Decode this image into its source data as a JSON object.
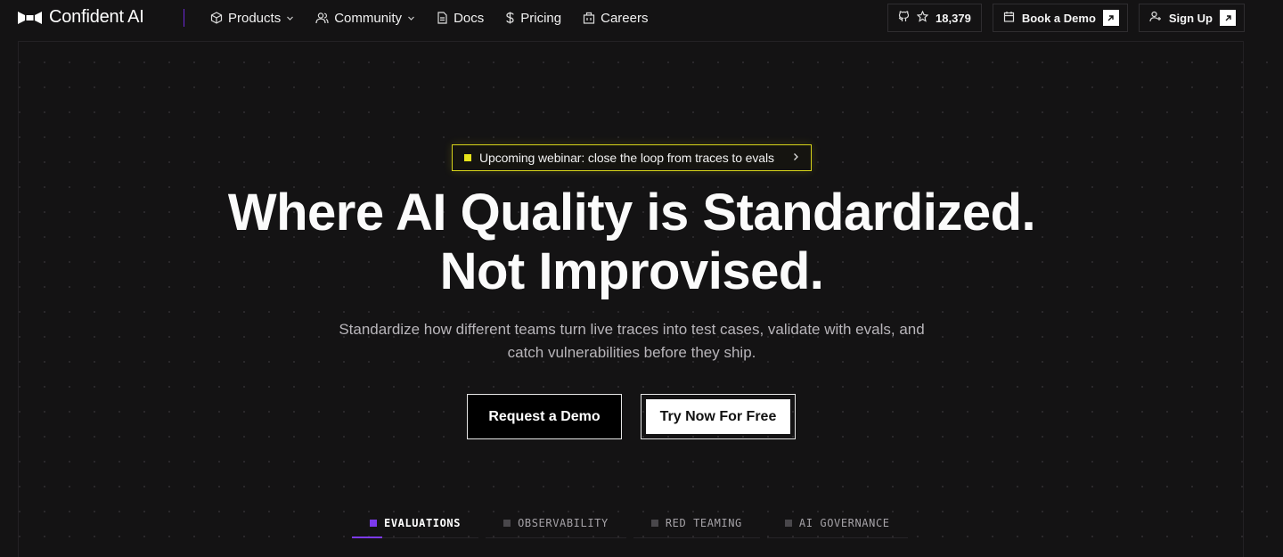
{
  "brand": {
    "name": "Confident AI"
  },
  "nav": {
    "items": [
      {
        "label": "Products",
        "icon": "cube-icon",
        "has_dropdown": true
      },
      {
        "label": "Community",
        "icon": "users-icon",
        "has_dropdown": true
      },
      {
        "label": "Docs",
        "icon": "document-icon",
        "has_dropdown": false
      },
      {
        "label": "Pricing",
        "icon": "dollar-icon",
        "has_dropdown": false
      },
      {
        "label": "Careers",
        "icon": "building-icon",
        "has_dropdown": false
      }
    ],
    "github_stars": "18,379",
    "book_demo": "Book a Demo",
    "sign_up": "Sign Up"
  },
  "banner": {
    "text": "Upcoming webinar: close the loop from traces to evals"
  },
  "hero": {
    "headline_line1": "Where AI Quality is Standardized.",
    "headline_line2": "Not Improvised.",
    "sub_line1": "Standardize how different teams turn live traces into test cases, validate with evals, and",
    "sub_line2": "catch vulnerabilities before they ship.",
    "cta_primary": "Request a Demo",
    "cta_secondary": "Try Now For Free"
  },
  "tabs": [
    {
      "label": "EVALUATIONS",
      "active": true
    },
    {
      "label": "OBSERVABILITY",
      "active": false
    },
    {
      "label": "RED TEAMING",
      "active": false
    },
    {
      "label": "AI GOVERNANCE",
      "active": false
    }
  ],
  "colors": {
    "background": "#141314",
    "accent_purple": "#7c3aed",
    "banner_yellow": "#e8e41a"
  }
}
